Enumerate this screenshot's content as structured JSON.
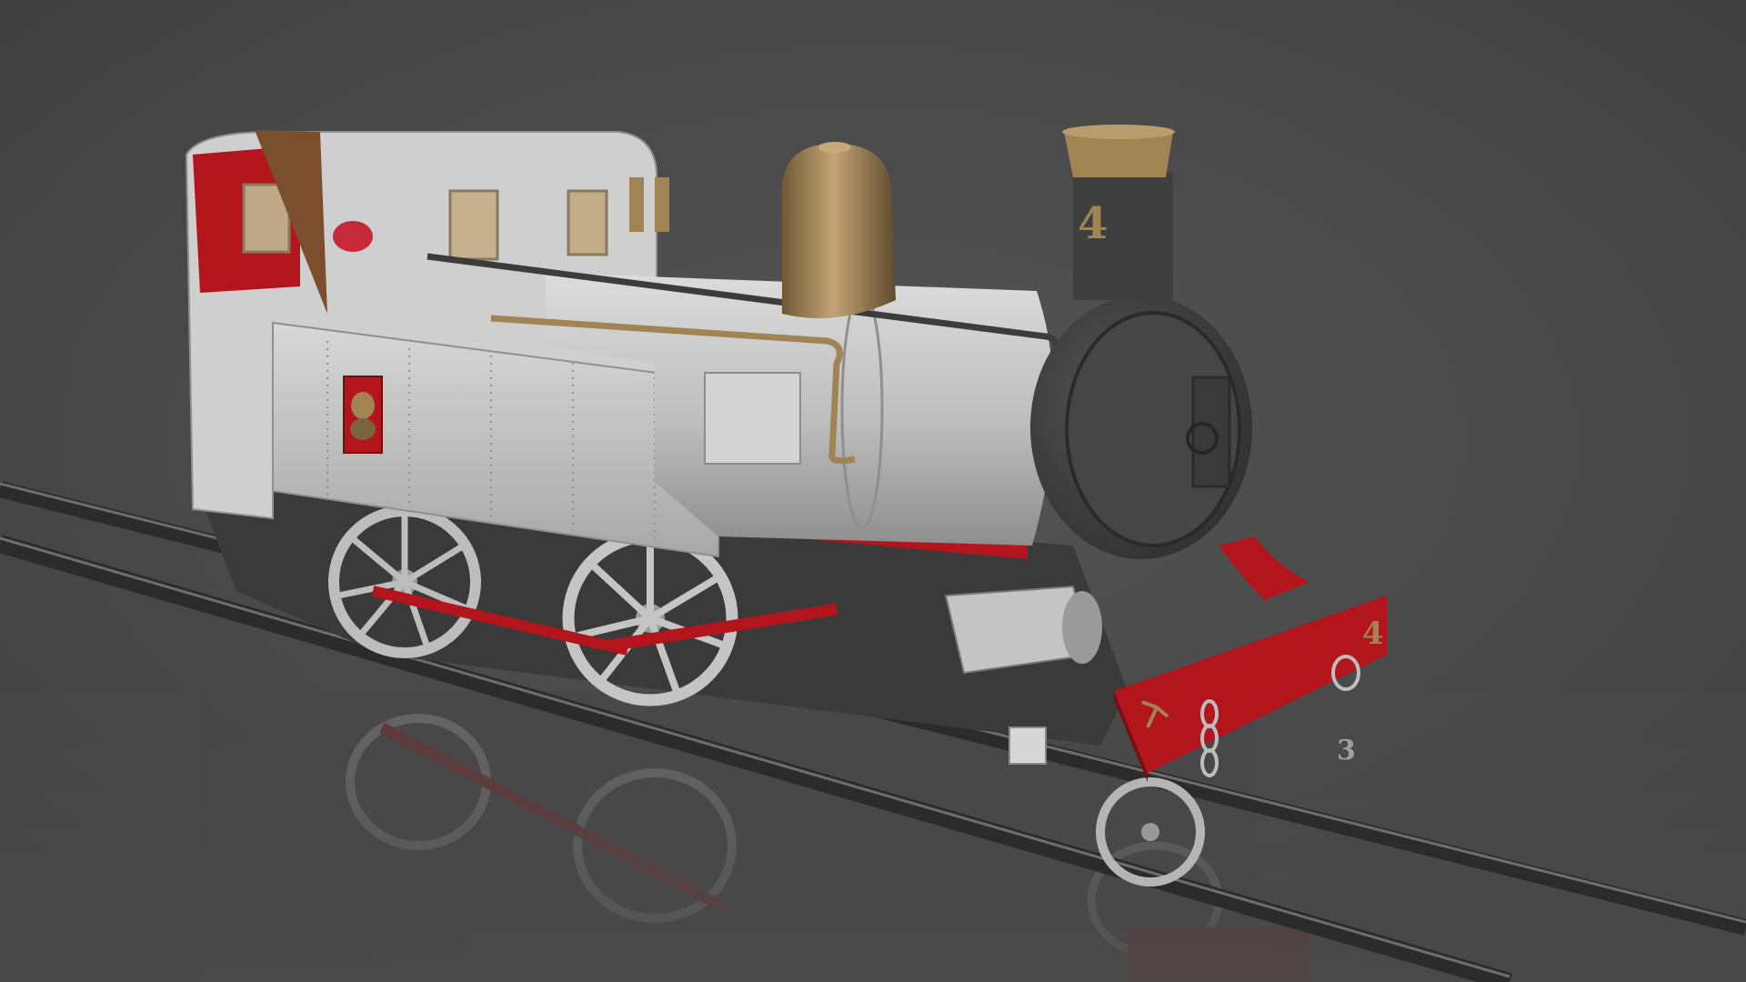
{
  "scene": {
    "chimney_number": "4",
    "buffer_number": "4",
    "coupling_hook_mark": "3",
    "colors": {
      "background": "#4a4a4a",
      "body_white": "#c9c9c9",
      "body_shadow": "#a9a9a9",
      "smokebox": "#3f3f3f",
      "brass": "#a08453",
      "red": "#b3151c",
      "rail": "#2f2f2f",
      "rail_highlight": "#7a7a7a"
    },
    "icons": [
      "steam-locomotive",
      "rail-track",
      "brass-steam-dome",
      "chimney",
      "spoked-wheel",
      "coat-of-arms-crest",
      "coupling-chain"
    ]
  }
}
